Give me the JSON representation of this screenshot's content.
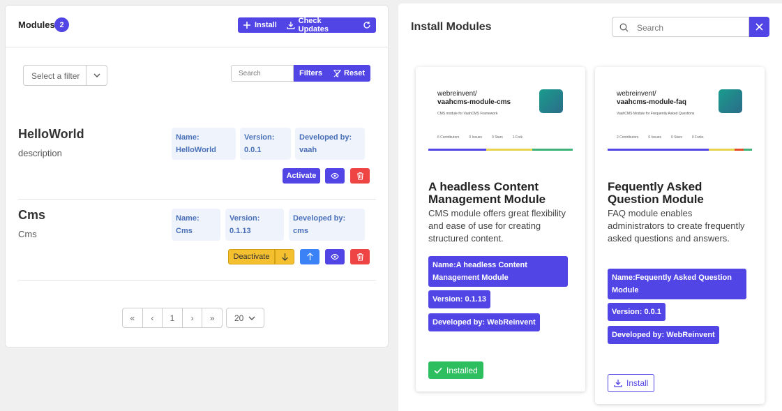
{
  "left": {
    "title": "Modules",
    "count": "2",
    "buttons": {
      "install": "Install",
      "check_updates": "Check Updates"
    },
    "filter_placeholder": "Select a filter",
    "search_placeholder": "Search",
    "filters_label": "Filters",
    "reset_label": "Reset",
    "modules": [
      {
        "name": "HelloWorld",
        "description": "description",
        "name_label": "Name:",
        "name_value": "HelloWorld",
        "version_label": "Version:",
        "version_value": "0.0.1",
        "dev_label": "Developed by:",
        "dev_value": "vaah",
        "action": "Activate"
      },
      {
        "name": "Cms",
        "description": "Cms",
        "name_label": "Name:",
        "name_value": "Cms",
        "version_label": "Version:",
        "version_value": "0.1.13",
        "dev_label": "Developed by:",
        "dev_value": "cms",
        "action": "Deactivate"
      }
    ],
    "pager": {
      "current": "1",
      "per_page": "20"
    }
  },
  "right": {
    "title": "Install Modules",
    "search_placeholder": "Search",
    "cards": [
      {
        "repo_owner": "webreinvent/",
        "repo_name": "vaahcms-module-cms",
        "repo_sub": "CMS module for VaahCMS Framework",
        "stats": [
          "6 Contributors",
          "0 Issues",
          "0 Stars",
          "1 Fork"
        ],
        "title": "A headless Content Management Module",
        "description": "CMS module offers great flexibility and ease of use for creating structured content.",
        "name_pill": "Name:A headless Content Management Module",
        "version_pill": "Version: 0.1.13",
        "dev_pill": "Developed by: WebReinvent",
        "button": "Installed"
      },
      {
        "repo_owner": "webreinvent/",
        "repo_name": "vaahcms-module-faq",
        "repo_sub": "VaahCMS Module for Frequently Asked Questions",
        "stats": [
          "2 Contributors",
          "0 Issues",
          "0 Stars",
          "0 Forks"
        ],
        "title": "Fequently Asked Question Module",
        "description": "FAQ module enables administrators to create frequently asked questions and answers.",
        "name_pill": "Name:Fequently Asked Question Module",
        "version_pill": "Version: 0.0.1",
        "dev_pill": "Developed by: WebReinvent",
        "button": "Install"
      }
    ]
  },
  "colors": {
    "primary": "#5145e6",
    "danger": "#ef4444",
    "warning": "#f4c02f",
    "success": "#2dbe60",
    "info": "#3b82f6"
  }
}
